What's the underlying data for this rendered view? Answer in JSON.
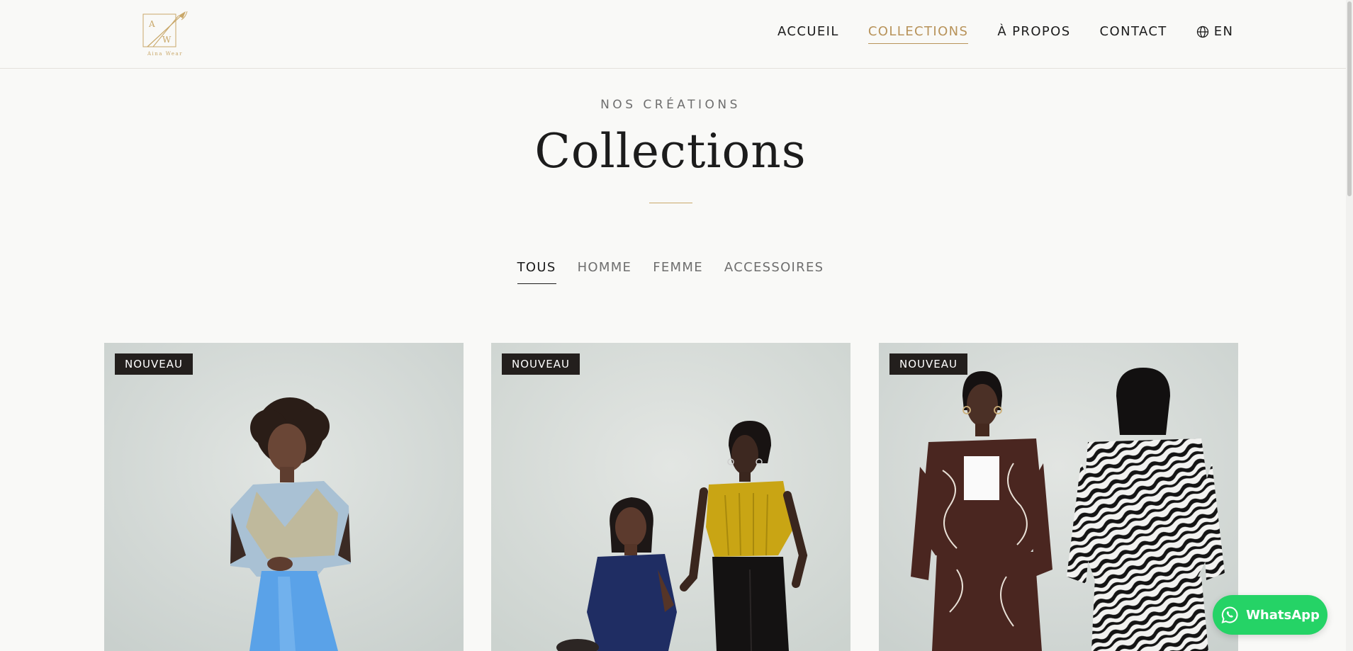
{
  "brand": {
    "logo_letters": [
      "A",
      "W"
    ],
    "logo_caption": "Aina Wear"
  },
  "nav": {
    "items": [
      {
        "label": "ACCUEIL",
        "active": false
      },
      {
        "label": "COLLECTIONS",
        "active": true
      },
      {
        "label": "À PROPOS",
        "active": false
      },
      {
        "label": "CONTACT",
        "active": false
      }
    ],
    "language": {
      "label": "EN",
      "icon": "globe-icon"
    }
  },
  "hero": {
    "eyebrow": "NOS CRÉATIONS",
    "title": "Collections"
  },
  "filters": [
    {
      "label": "TOUS",
      "active": true
    },
    {
      "label": "HOMME",
      "active": false
    },
    {
      "label": "FEMME",
      "active": false
    },
    {
      "label": "ACCESSOIRES",
      "active": false
    }
  ],
  "products": [
    {
      "badge": "NOUVEAU",
      "image": "woman-in-blue-and-gold-wrap-dress"
    },
    {
      "badge": "NOUVEAU",
      "image": "two-women-navy-and-yellow-tops"
    },
    {
      "badge": "NOUVEAU",
      "image": "two-models-printed-pajama-sets"
    }
  ],
  "whatsapp": {
    "label": "WhatsApp",
    "icon": "whatsapp-icon"
  },
  "colors": {
    "background": "#f9f9f7",
    "accent_gold": "#b8935a",
    "text": "#1c1c1c",
    "badge_bg": "#231f1d",
    "whatsapp_green": "#25d366"
  }
}
